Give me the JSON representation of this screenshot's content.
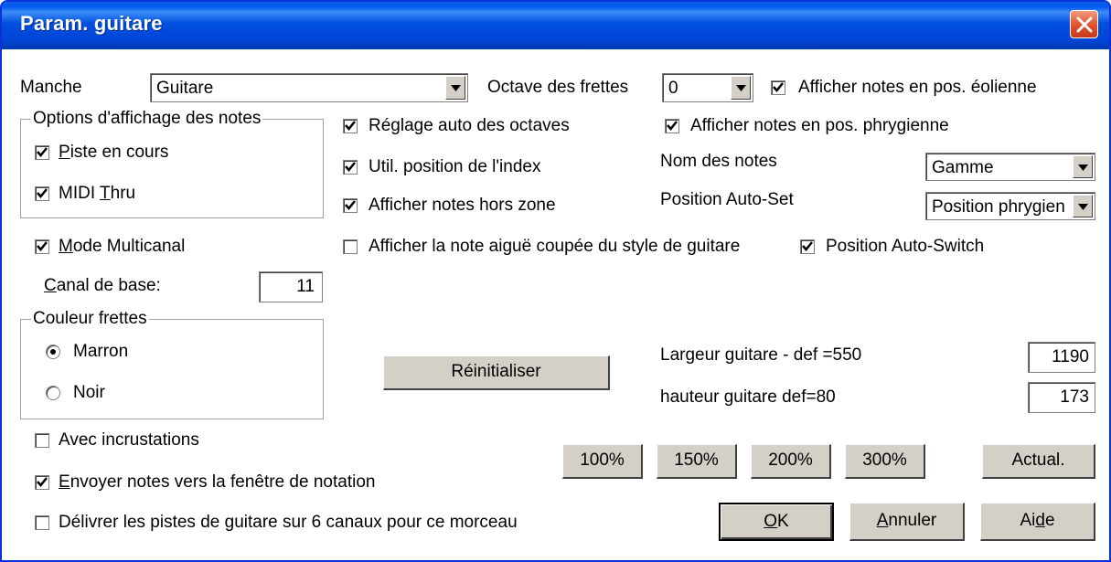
{
  "window": {
    "title": "Param. guitare"
  },
  "manche": {
    "label": "Manche",
    "value": "Guitare"
  },
  "octave": {
    "label": "Octave des frettes",
    "value": "0"
  },
  "checkboxes": {
    "eolienne": {
      "label": "Afficher notes en pos. éolienne",
      "checked": true
    },
    "reglage_auto": {
      "label": "Réglage auto des octaves",
      "checked": true
    },
    "phrygienne": {
      "label": "Afficher notes en pos. phrygienne",
      "checked": true
    },
    "util_index": {
      "label": "Util. position de l'index",
      "checked": true
    },
    "hors_zone": {
      "label": "Afficher notes hors zone",
      "checked": true
    },
    "mode_multicanal": {
      "label_u": "M",
      "label_rest": "ode Multicanal",
      "checked": true
    },
    "note_aigue": {
      "label": "Afficher la note aiguë coupée du style de guitare",
      "checked": false
    },
    "auto_switch": {
      "label": "Position Auto-Switch",
      "checked": true
    },
    "incrustations": {
      "label": "Avec incrustations",
      "checked": false
    },
    "envoyer": {
      "label_u": "E",
      "label_rest": "nvoyer notes vers la fenêtre de notation",
      "checked": true
    },
    "delivrer": {
      "label": "Délivrer les pistes de guitare sur 6 canaux pour ce morceau",
      "checked": false
    }
  },
  "options_group": {
    "title": "Options d'affichage des notes",
    "piste": {
      "label_u": "P",
      "label_rest": "iste en cours",
      "checked": true
    },
    "midi_thru": {
      "label_pre": "MIDI ",
      "label_u": "T",
      "label_rest": "hru",
      "checked": true
    }
  },
  "nom_notes": {
    "label": "Nom des notes",
    "value": "Gamme"
  },
  "position_autoset": {
    "label": "Position Auto-Set",
    "value": "Position phrygien"
  },
  "canal": {
    "label_u": "C",
    "label_rest": "anal de base:",
    "value": "11"
  },
  "couleur_group": {
    "title": "Couleur frettes",
    "marron": {
      "label": "Marron",
      "selected": true
    },
    "noir": {
      "label": "Noir",
      "selected": false
    }
  },
  "reinit_button": "Réinitialiser",
  "largeur": {
    "label": "Largeur guitare - def =550",
    "value": "1190"
  },
  "hauteur": {
    "label": "hauteur guitare def=80",
    "value": "173"
  },
  "zoom_buttons": [
    "100%",
    "150%",
    "200%",
    "300%"
  ],
  "actual_button": "Actual.",
  "ok_button": {
    "u": "O",
    "rest": "K"
  },
  "annuler_button": {
    "u": "A",
    "rest": "nnuler"
  },
  "aide_button": {
    "pre": "Ai",
    "u": "d",
    "rest": "e"
  }
}
